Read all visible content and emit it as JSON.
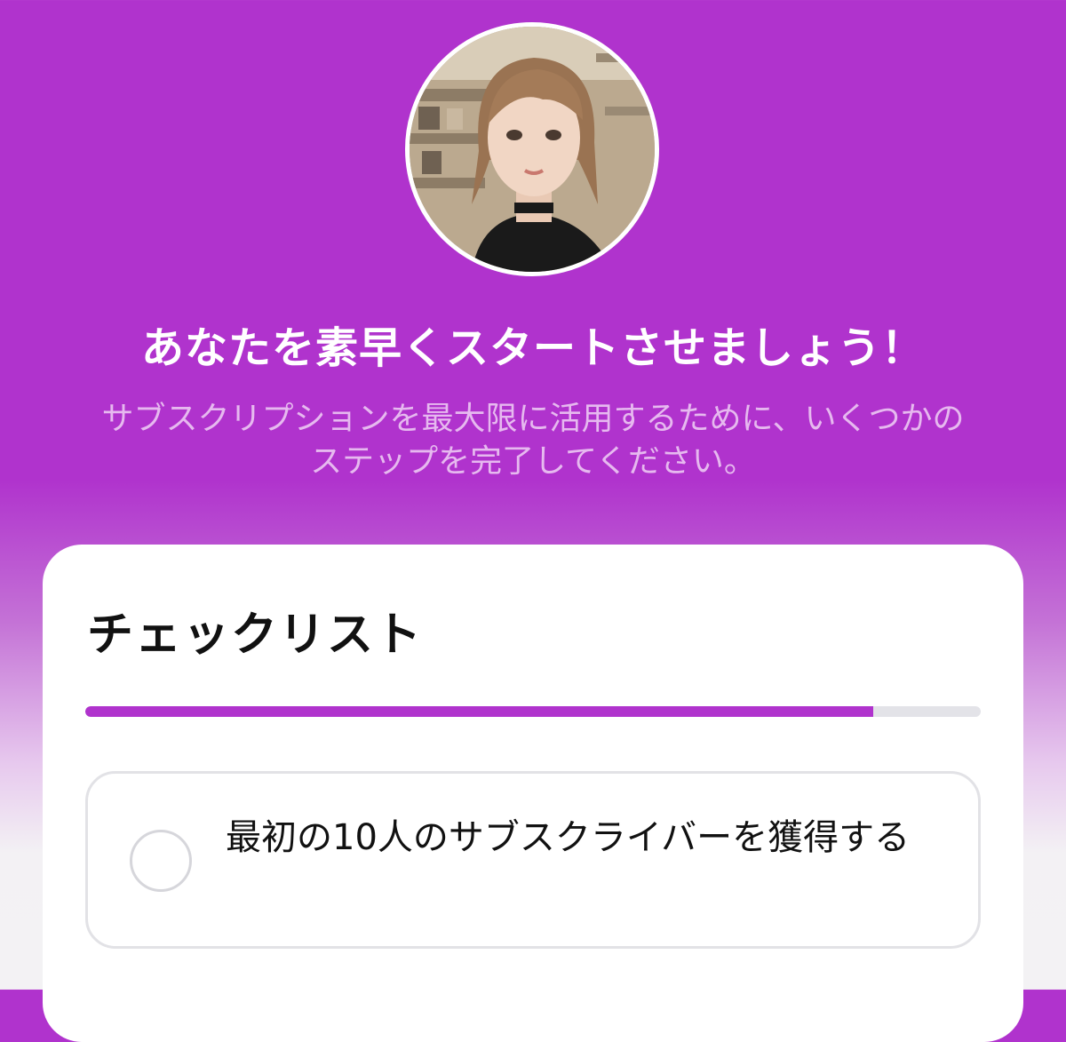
{
  "onboarding": {
    "headline": "あなたを素早くスタートさせましょう！",
    "subtitle": "サブスクリプションを最大限に活用するために、いくつかのステップを完了してください。"
  },
  "checklist": {
    "title": "チェックリスト",
    "progress": 0.88,
    "items": [
      {
        "label": "最初の10人のサブスクライバーを獲得する",
        "checked": false
      }
    ]
  },
  "colors": {
    "accent": "#b033cd",
    "progress_track": "#e3e3e8"
  }
}
